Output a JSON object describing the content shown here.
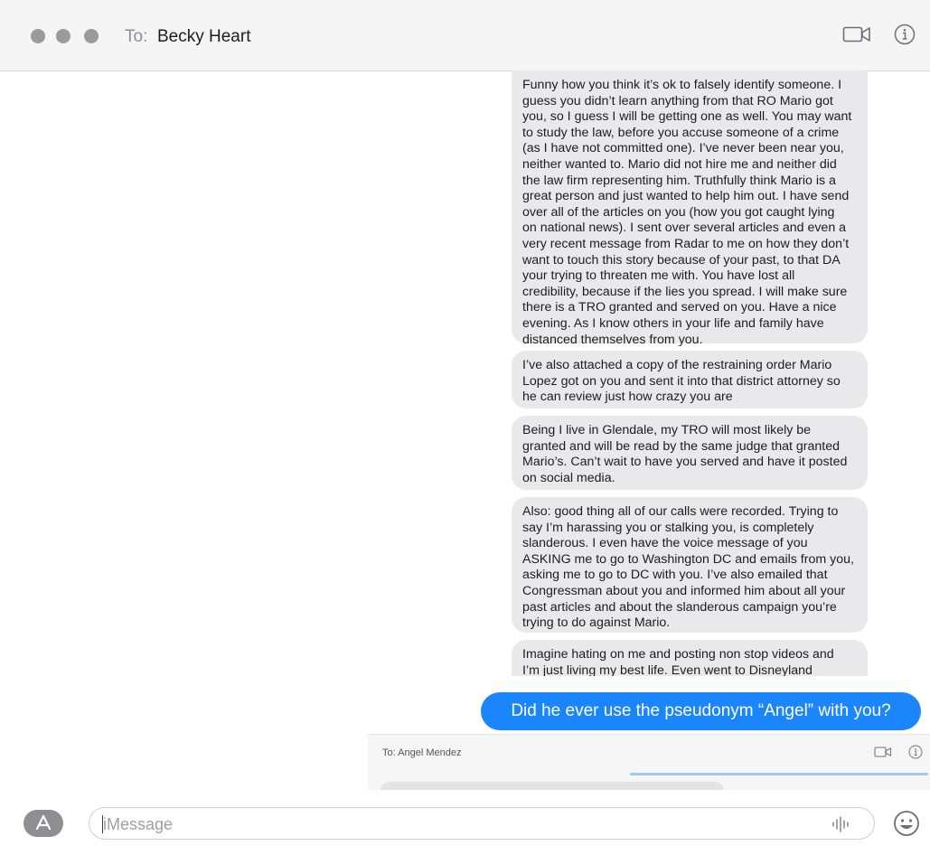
{
  "header": {
    "to_label": "To:",
    "recipient": "Becky Heart"
  },
  "messages": [
    {
      "text": "Funny how you think it’s ok to falsely identify someone. I\nguess you didn’t learn anything from that RO Mario got\nyou, so I guess I will be getting one as well. You may want\nto study the law, before you accuse someone of a crime\n(as I have not committed one). I’ve never been near you,\nneither wanted to. Mario did not hire me and neither did\nthe law firm representing him. Truthfully think Mario is a\ngreat person and just wanted to help him out. I have send\nover all of the articles on you (how you got caught lying\non national news). I sent over several articles and even a\nvery recent message from Radar to me on how they don’t\nwant to touch this story because of your past, to that DA\nyour trying to threaten me with. You have lost all\ncredibility, because if the lies you spread. I will make sure\nthere is a TRO granted and served on you. Have a nice\nevening. As I know others in your life and family have\ndistanced themselves from you."
    },
    {
      "text": "I’ve also attached a copy of the restraining order Mario\nLopez got on you and sent it into that district attorney so\nhe can review just how crazy you are"
    },
    {
      "text": "Being I live in Glendale, my TRO will most likely be\ngranted and will be read by the same judge that granted\nMario’s. Can’t wait to have you served and have it posted\non social media."
    },
    {
      "text": "Also: good thing all of our calls were recorded. Trying to\nsay I’m harassing you or stalking you, is completely\nslanderous. I even have the voice message of you\nASKING me to go to Washington DC and emails from you,\nasking me to go to DC with you. I’ve also emailed that\nCongressman about you and informed him about all your\npast articles and about the slanderous campaign you’re\ntrying to do against Mario."
    },
    {
      "text": "Imagine hating on me and posting non stop videos and\nI’m just living my best life. Even went to Disneyland"
    }
  ],
  "sent_message": "Did he ever use the pseudonym “Angel” with you?",
  "embedded_screenshot": {
    "to_label": "To: Angel Mendez"
  },
  "composer": {
    "placeholder": "iMessage"
  },
  "icons": [
    "video-call-icon",
    "info-icon",
    "app-store-icon",
    "audio-waveform-icon",
    "emoji-icon",
    "video-call-icon-small",
    "info-icon-small"
  ],
  "colors": {
    "sent_bubble": "#1b86fb",
    "received_bubble": "#e9e9eb",
    "header_bg": "#f4f5f4"
  }
}
